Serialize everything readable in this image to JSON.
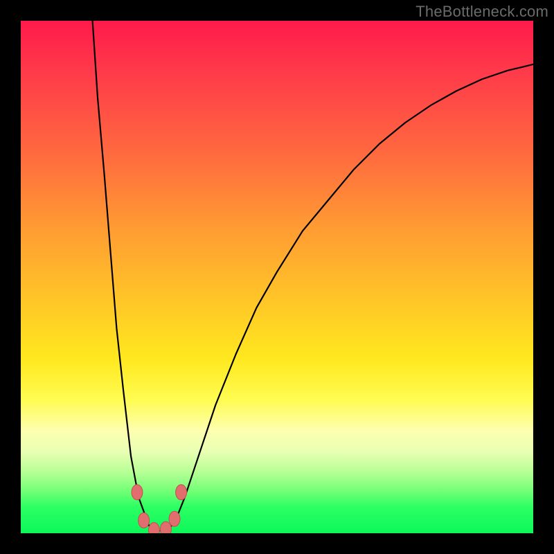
{
  "watermark": "TheBottleneck.com",
  "chart_data": {
    "type": "line",
    "title": "",
    "xlabel": "",
    "ylabel": "",
    "xlim": [
      0,
      100
    ],
    "ylim": [
      0,
      100
    ],
    "series": [
      {
        "name": "curve",
        "x": [
          14.0,
          15.0,
          16.3,
          17.5,
          18.7,
          20.0,
          21.5,
          23.0,
          25.0,
          26.8,
          28.5,
          30.0,
          32.0,
          34.0,
          38.0,
          42.0,
          46.0,
          50.0,
          55.0,
          60.0,
          65.0,
          70.0,
          75.0,
          80.0,
          85.0,
          90.0,
          95.0,
          98.0,
          100.0
        ],
        "values": [
          100.0,
          85.0,
          70.0,
          55.0,
          40.0,
          28.0,
          15.0,
          7.0,
          1.5,
          0.5,
          0.6,
          2.0,
          7.0,
          13.0,
          25.0,
          35.0,
          44.0,
          51.0,
          59.0,
          65.0,
          71.0,
          76.0,
          80.1,
          83.5,
          86.3,
          88.6,
          90.3,
          91.0,
          91.5
        ]
      }
    ],
    "markers": [
      {
        "x": 22.7,
        "y": 8.0
      },
      {
        "x": 24.0,
        "y": 2.5
      },
      {
        "x": 26.0,
        "y": 0.6
      },
      {
        "x": 28.3,
        "y": 0.8
      },
      {
        "x": 30.0,
        "y": 2.8
      },
      {
        "x": 31.3,
        "y": 8.0
      }
    ]
  }
}
